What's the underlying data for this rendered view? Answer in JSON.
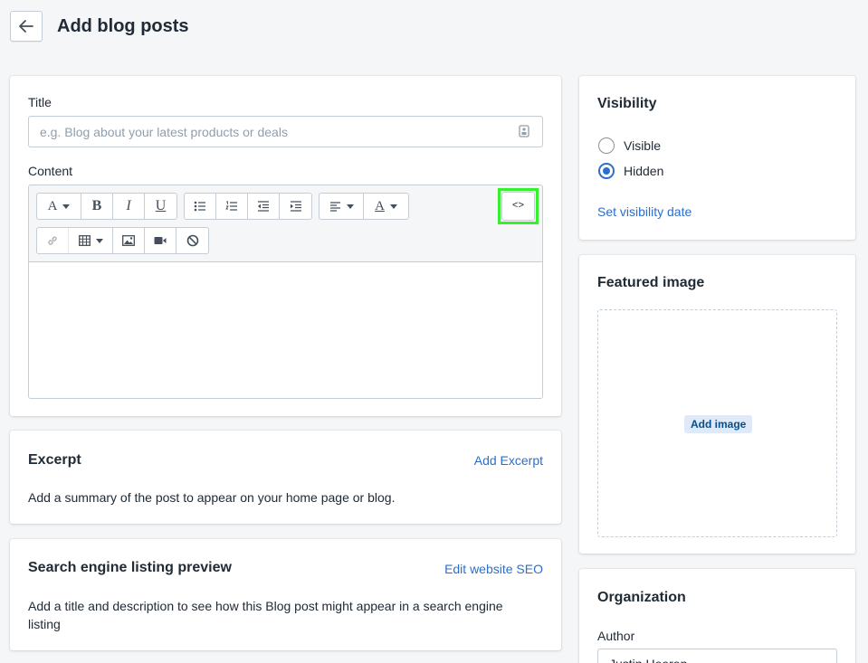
{
  "header": {
    "title": "Add blog posts",
    "back_icon": "arrow-left-icon"
  },
  "main": {
    "title_label": "Title",
    "title_placeholder": "e.g. Blog about your latest products or deals",
    "title_value": "",
    "content_label": "Content",
    "toolbar": {
      "row1": [
        "font-style-dropdown",
        "bold",
        "italic",
        "underline",
        "bulleted-list",
        "numbered-list",
        "outdent",
        "indent",
        "alignment-dropdown",
        "text-color-dropdown"
      ],
      "row2": [
        "link",
        "table-dropdown",
        "insert-image",
        "insert-video",
        "clear-formatting"
      ],
      "show_html_label": "<>",
      "font_glyph": "A",
      "bold_glyph": "B",
      "italic_glyph": "I",
      "underline_glyph": "U",
      "color_glyph": "A"
    }
  },
  "excerpt": {
    "heading": "Excerpt",
    "action": "Add Excerpt",
    "description": "Add a summary of the post to appear on your home page or blog."
  },
  "seo": {
    "heading": "Search engine listing preview",
    "action": "Edit website SEO",
    "description": "Add a title and description to see how this Blog post might appear in a search engine listing"
  },
  "visibility": {
    "heading": "Visibility",
    "options": [
      {
        "label": "Visible",
        "checked": false
      },
      {
        "label": "Hidden",
        "checked": true
      }
    ],
    "date_link": "Set visibility date"
  },
  "featured_image": {
    "heading": "Featured image",
    "add_label": "Add image"
  },
  "organization": {
    "heading": "Organization",
    "author_label": "Author",
    "author_value": "Justin Heeren"
  },
  "colors": {
    "link": "#2c6ecb",
    "highlight": "#36f02e",
    "background": "#f4f6f8"
  }
}
